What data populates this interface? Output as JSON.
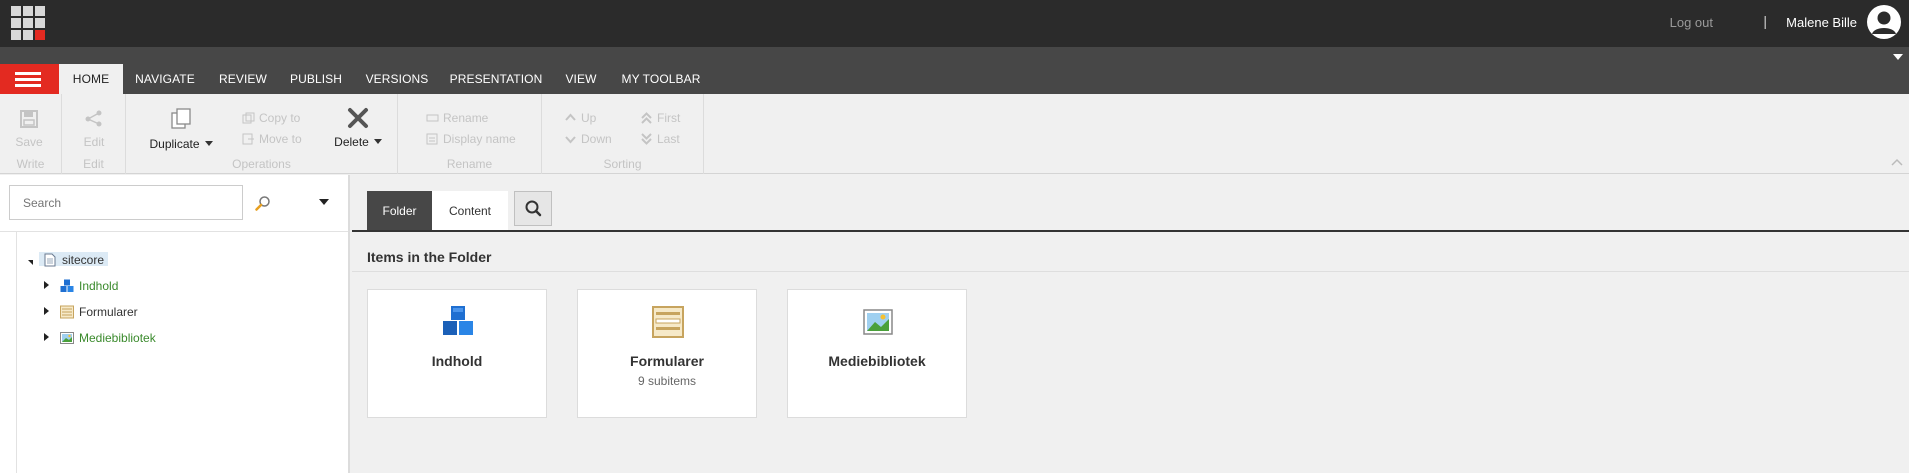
{
  "topbar": {
    "logout_label": "Log out",
    "separator": "|",
    "username": "Malene Bille"
  },
  "ribbon_tabs": [
    "HOME",
    "NAVIGATE",
    "REVIEW",
    "PUBLISH",
    "VERSIONS",
    "PRESENTATION",
    "VIEW",
    "MY TOOLBAR"
  ],
  "active_ribbon_tab": "HOME",
  "ribbon": {
    "write": {
      "label": "Write",
      "save_label": "Save"
    },
    "edit": {
      "label": "Edit",
      "edit_label": "Edit"
    },
    "operations": {
      "label": "Operations",
      "duplicate_label": "Duplicate",
      "copy_to_label": "Copy to",
      "move_to_label": "Move to",
      "delete_label": "Delete"
    },
    "rename": {
      "label": "Rename",
      "rename_label": "Rename",
      "display_name_label": "Display name"
    },
    "sorting": {
      "label": "Sorting",
      "up_label": "Up",
      "down_label": "Down",
      "first_label": "First",
      "last_label": "Last"
    }
  },
  "search": {
    "placeholder": "Search"
  },
  "tree": {
    "root": {
      "label": "sitecore"
    },
    "children": [
      {
        "label": "Indhold",
        "color": "#3a8a2c",
        "icon": "cubes-icon"
      },
      {
        "label": "Formularer",
        "color": "#333333",
        "icon": "form-icon"
      },
      {
        "label": "Mediebibliotek",
        "color": "#3a8a2c",
        "icon": "image-icon"
      }
    ]
  },
  "view_tabs": {
    "folder_label": "Folder",
    "content_label": "Content",
    "active": "Folder"
  },
  "main": {
    "section_title": "Items in the Folder",
    "items": [
      {
        "name": "Indhold",
        "sub": "",
        "icon": "cubes-icon"
      },
      {
        "name": "Formularer",
        "sub": "9 subitems",
        "icon": "form-icon"
      },
      {
        "name": "Mediebibliotek",
        "sub": "",
        "icon": "image-icon"
      }
    ]
  },
  "colors": {
    "accent_red": "#e32a21",
    "topbar": "#2b2b2b",
    "tabstrip": "#474747",
    "tree_green": "#3a8a2c"
  }
}
